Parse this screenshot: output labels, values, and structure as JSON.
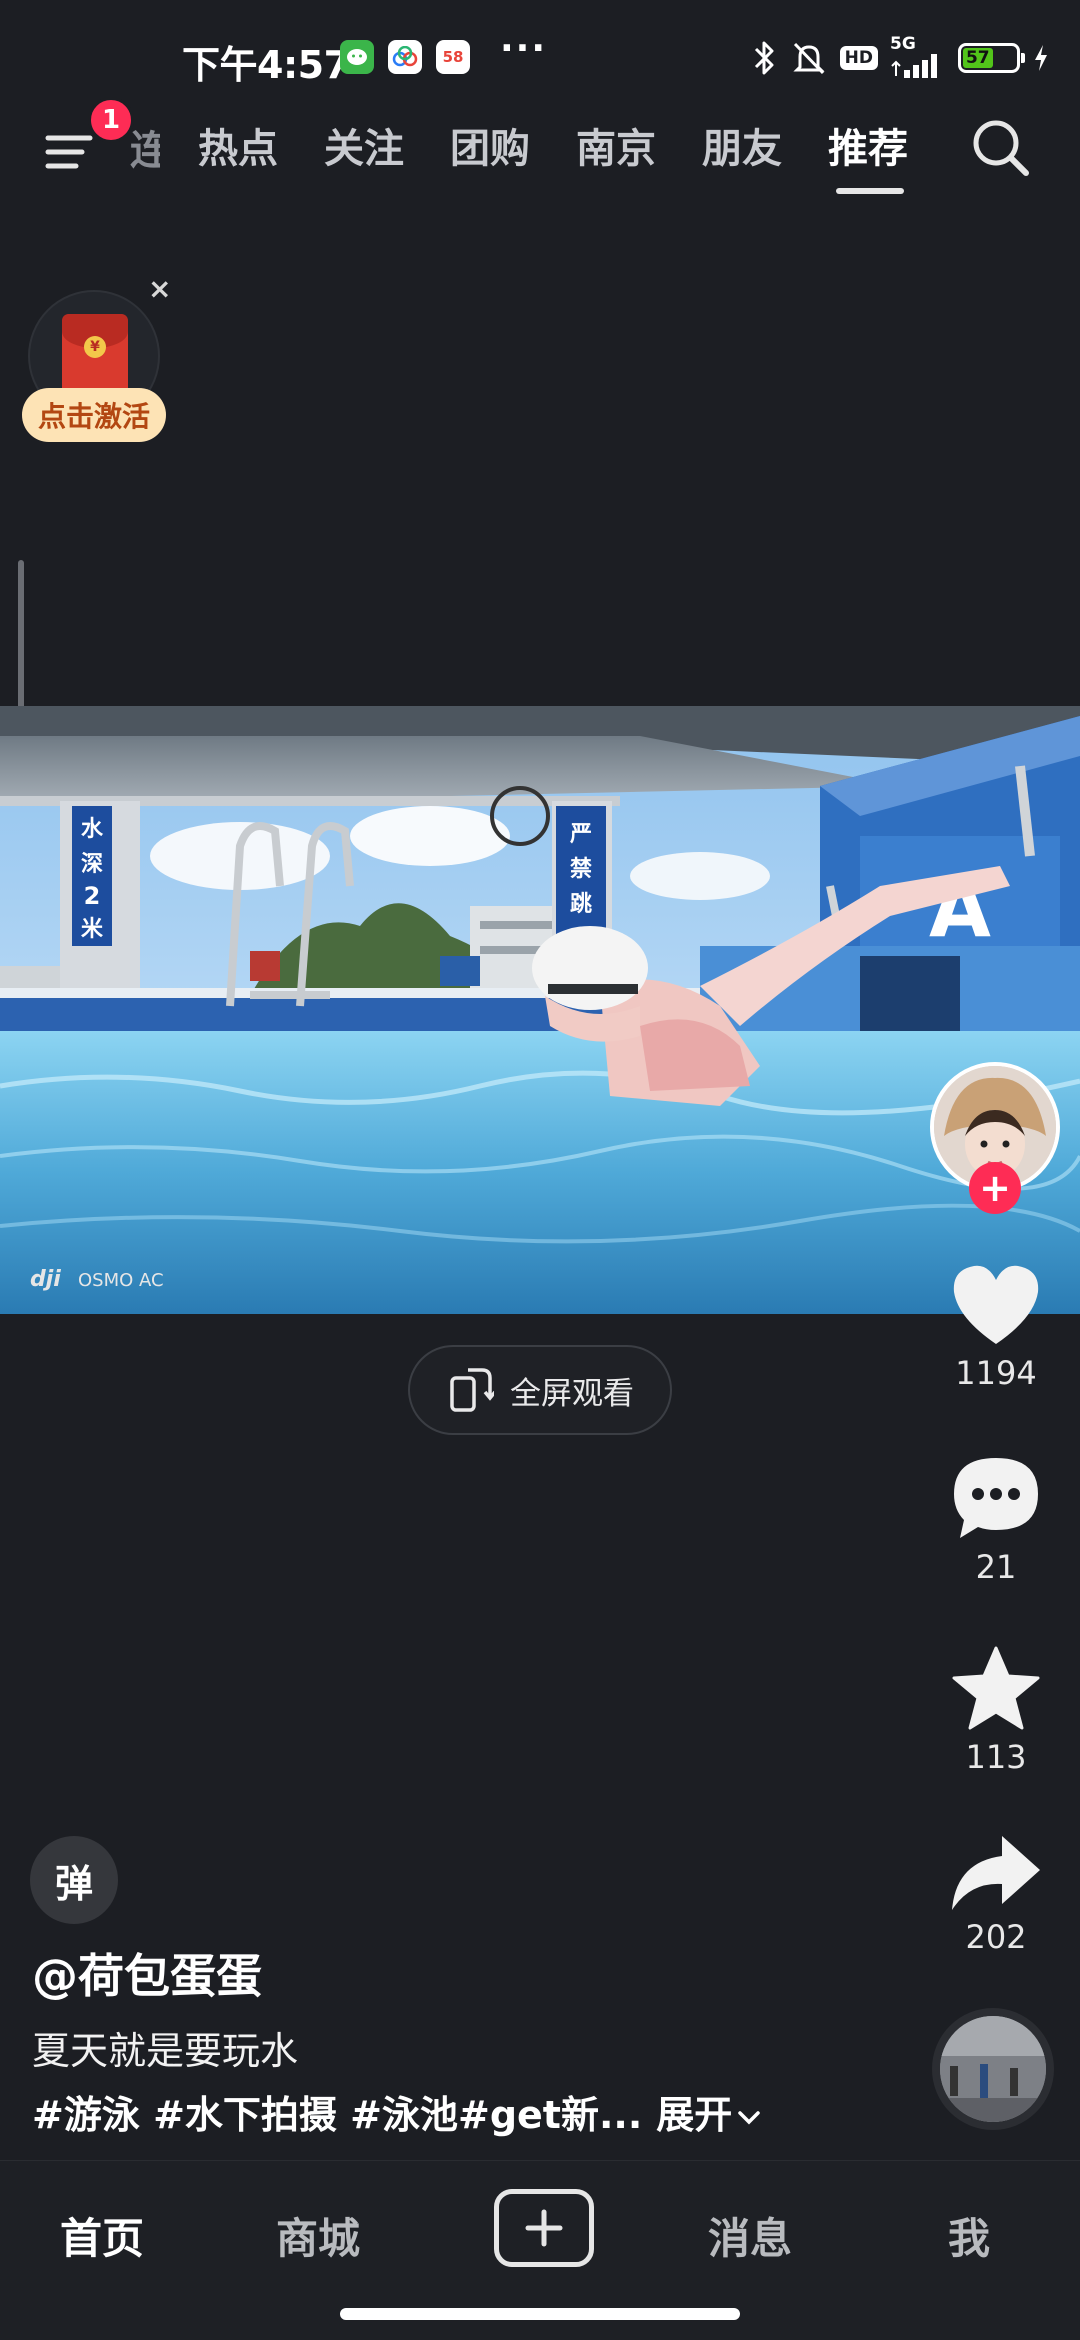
{
  "status_bar": {
    "time": "下午4:57",
    "app_badge_58": "58",
    "more": "···",
    "hd": "HD",
    "network": "5G",
    "battery": "57"
  },
  "top_nav": {
    "menu_badge": "1",
    "partial_tab": "连",
    "tabs": [
      "热点",
      "关注",
      "团购",
      "南京",
      "朋友",
      "推荐"
    ],
    "active_tab": "推荐"
  },
  "promo": {
    "label": "点击激活",
    "close": "×"
  },
  "video": {
    "watermark": "OSMO AC",
    "sign_left": "水深2米",
    "sign_right": "严禁跳水",
    "fullscreen_label": "全屏观看"
  },
  "actions": {
    "likes": "1194",
    "comments": "21",
    "favorites": "113",
    "shares": "202"
  },
  "caption": {
    "danmu": "弹",
    "author": "@荷包蛋蛋",
    "description": "夏天就是要玩水",
    "tags": "#游泳 #水下拍摄 #泳池#get新...",
    "expand": "展开"
  },
  "bottom_nav": {
    "items": [
      "首页",
      "商城",
      "消息",
      "我"
    ]
  },
  "colors": {
    "background": "#1c1e23",
    "accent": "#fe2c55",
    "pool_water": "#4fa9d8"
  }
}
